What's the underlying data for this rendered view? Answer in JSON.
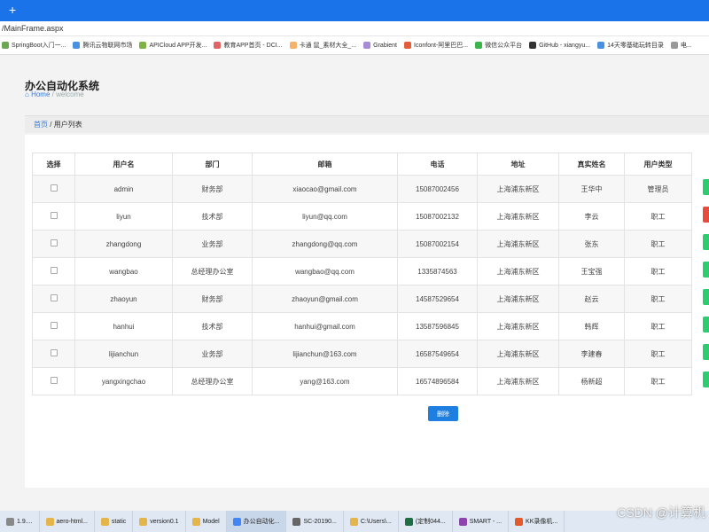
{
  "browser": {
    "new_tab": "+",
    "address": "/MainFrame.aspx",
    "bookmarks": [
      {
        "label": "SpringBoot入门一...",
        "color": "#6aa84f"
      },
      {
        "label": "腾讯云物联网市场",
        "color": "#4a90e2"
      },
      {
        "label": "APICloud APP开发...",
        "color": "#7cb342"
      },
      {
        "label": "教育APP首页 - DCI...",
        "color": "#e06666"
      },
      {
        "label": "卡通 鼠_素材大全_...",
        "color": "#f6b26b"
      },
      {
        "label": "Grabient",
        "color": "#a78bd6"
      },
      {
        "label": "Iconfont-阿里巴巴...",
        "color": "#e35d3a"
      },
      {
        "label": "微信公众平台",
        "color": "#3bb54a"
      },
      {
        "label": "GitHub - xiangyu...",
        "color": "#333333"
      },
      {
        "label": "14天零基础玩转目录",
        "color": "#4a90e2"
      },
      {
        "label": "电...",
        "color": "#999999"
      }
    ]
  },
  "app": {
    "title": "办公自动化系统",
    "home_label": "Home",
    "breadcrumb_sep": "/",
    "breadcrumb_page": "welcome"
  },
  "crumb": {
    "home": "首页",
    "sep": "/",
    "current": "用户列表"
  },
  "table": {
    "headers": [
      "选择",
      "用户名",
      "部门",
      "邮箱",
      "电话",
      "地址",
      "真实姓名",
      "用户类型"
    ],
    "rows": [
      {
        "username": "admin",
        "dept": "财务部",
        "email": "xiaocao@gmail.com",
        "phone": "15087002456",
        "address": "上海浦东新区",
        "realname": "王华中",
        "type": "管理员"
      },
      {
        "username": "liyun",
        "dept": "技术部",
        "email": "liyun@qq.com",
        "phone": "15087002132",
        "address": "上海浦东新区",
        "realname": "李云",
        "type": "职工"
      },
      {
        "username": "zhangdong",
        "dept": "业务部",
        "email": "zhangdong@qq.com",
        "phone": "15087002154",
        "address": "上海浦东新区",
        "realname": "张东",
        "type": "职工"
      },
      {
        "username": "wangbao",
        "dept": "总经理办公室",
        "email": "wangbao@qq.com",
        "phone": "1335874563",
        "address": "上海浦东新区",
        "realname": "王宝强",
        "type": "职工"
      },
      {
        "username": "zhaoyun",
        "dept": "财务部",
        "email": "zhaoyun@gmail.com",
        "phone": "14587529654",
        "address": "上海浦东新区",
        "realname": "赵云",
        "type": "职工"
      },
      {
        "username": "hanhui",
        "dept": "技术部",
        "email": "hanhui@gmail.com",
        "phone": "13587596845",
        "address": "上海浦东新区",
        "realname": "韩辉",
        "type": "职工"
      },
      {
        "username": "lijianchun",
        "dept": "业务部",
        "email": "lijianchun@163.com",
        "phone": "16587549654",
        "address": "上海浦东新区",
        "realname": "李建春",
        "type": "职工"
      },
      {
        "username": "yangxingchao",
        "dept": "总经理办公室",
        "email": "yang@163.com",
        "phone": "16574896584",
        "address": "上海浦东新区",
        "realname": "杨新超",
        "type": "职工"
      }
    ],
    "edge_colors": [
      "#2ecc71",
      "#e74c3c",
      "#2ecc71",
      "#2ecc71",
      "#2ecc71",
      "#2ecc71",
      "#2ecc71",
      "#2ecc71"
    ]
  },
  "actions": {
    "delete_label": "删除"
  },
  "taskbar": {
    "items": [
      {
        "label": "1.9....",
        "color": "#888888"
      },
      {
        "label": "aero-html...",
        "color": "#e4b54a"
      },
      {
        "label": "static",
        "color": "#e4b54a"
      },
      {
        "label": "version0.1",
        "color": "#e4b54a"
      },
      {
        "label": "Model",
        "color": "#e4b54a"
      },
      {
        "label": "办公自动化...",
        "color": "#4285f4"
      },
      {
        "label": "SC-20190...",
        "color": "#666666"
      },
      {
        "label": "C:\\Users\\...",
        "color": "#e4b54a"
      },
      {
        "label": "(定制044...",
        "color": "#1d6f42"
      },
      {
        "label": "SMART - ...",
        "color": "#8e44ad"
      },
      {
        "label": "KK录像机...",
        "color": "#e05a2b"
      }
    ],
    "watermark": "CSDN @计算机"
  }
}
